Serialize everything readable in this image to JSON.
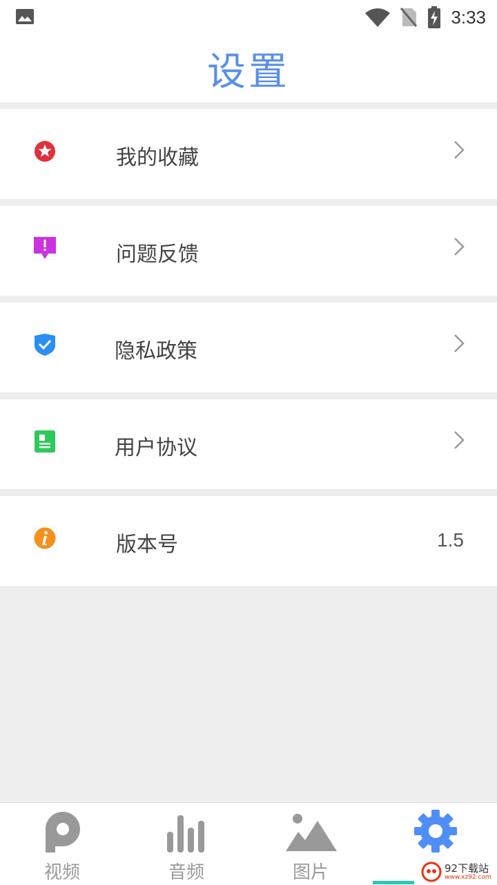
{
  "status": {
    "time": "3:33"
  },
  "header": {
    "title": "设置"
  },
  "menu": [
    {
      "label": "我的收藏",
      "icon": "favorite-star-icon"
    },
    {
      "label": "问题反馈",
      "icon": "feedback-alert-icon"
    },
    {
      "label": "隐私政策",
      "icon": "privacy-shield-icon"
    },
    {
      "label": "用户协议",
      "icon": "agreement-document-icon"
    },
    {
      "label": "版本号",
      "icon": "info-icon",
      "value": "1.5"
    }
  ],
  "nav": [
    {
      "label": "视频",
      "icon": "video-p-icon"
    },
    {
      "label": "音频",
      "icon": "audio-bars-icon"
    },
    {
      "label": "图片",
      "icon": "image-mountain-icon"
    },
    {
      "label": "",
      "icon": "settings-gear-icon",
      "active": true
    }
  ],
  "watermark": {
    "text": "92下载站",
    "sub": "www.xz92.com"
  },
  "colors": {
    "accent": "#5b8fe6",
    "indicator": "#2ec4b6"
  }
}
